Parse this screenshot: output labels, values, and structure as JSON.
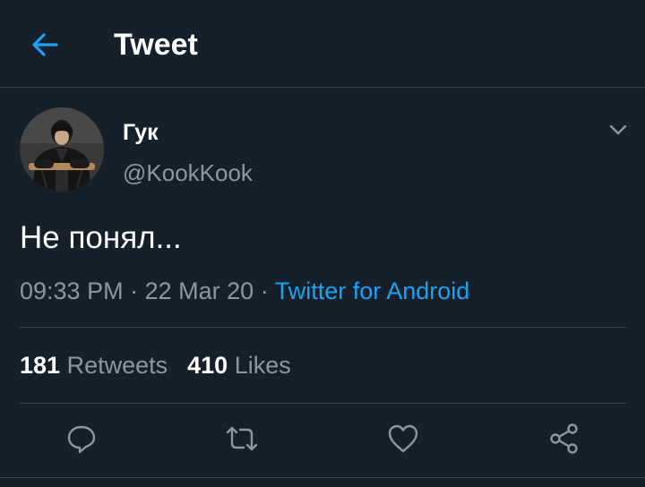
{
  "header": {
    "title": "Tweet",
    "back_icon": "arrow-left-icon"
  },
  "tweet": {
    "display_name": "Гук",
    "handle": "@KookKook",
    "text": "Не понял...",
    "time": "09:33 PM",
    "date": "22 Mar 20",
    "separator": "·",
    "source": "Twitter for Android"
  },
  "stats": {
    "retweets_count": "181",
    "retweets_label": "Retweets",
    "likes_count": "410",
    "likes_label": "Likes"
  },
  "actions": [
    "reply-icon",
    "retweet-icon",
    "like-icon",
    "share-icon"
  ],
  "colors": {
    "background": "#15202b",
    "accent": "#1da1f2",
    "secondary_text": "#8899a6",
    "divider": "#38444d"
  }
}
